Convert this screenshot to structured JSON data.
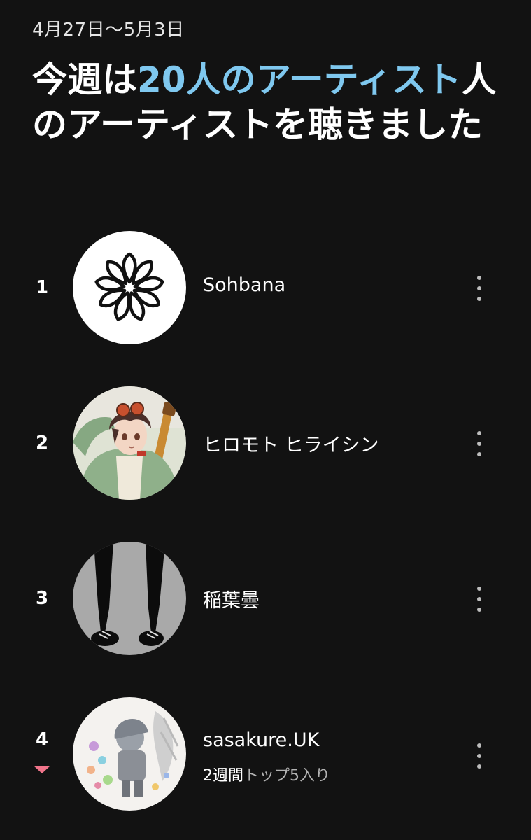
{
  "header": {
    "date_range": "4月27日〜5月3日",
    "headline_prefix": "今週は",
    "headline_accent": "20人のアーティスト",
    "headline_suffix": "人のアーティストを聴きました",
    "accent_color": "#7fc8ef"
  },
  "artists": [
    {
      "rank": "1",
      "name": "Sohbana",
      "avatar": "flower-logo"
    },
    {
      "rank": "2",
      "name": "ヒロモト ヒライシン",
      "avatar": "anime-boy-with-guitar"
    },
    {
      "rank": "3",
      "name": "稲葉曇",
      "avatar": "silhouette-legs"
    },
    {
      "rank": "4",
      "name": "sasakure.UK",
      "avatar": "pastel-illustration",
      "rank_change": "down",
      "rank_change_color": "#f0748a",
      "sub_strong": "2週間",
      "sub_rest": "トップ5入り"
    }
  ],
  "icons": {
    "more": "more-vertical-icon",
    "rank_down": "triangle-down-icon"
  }
}
